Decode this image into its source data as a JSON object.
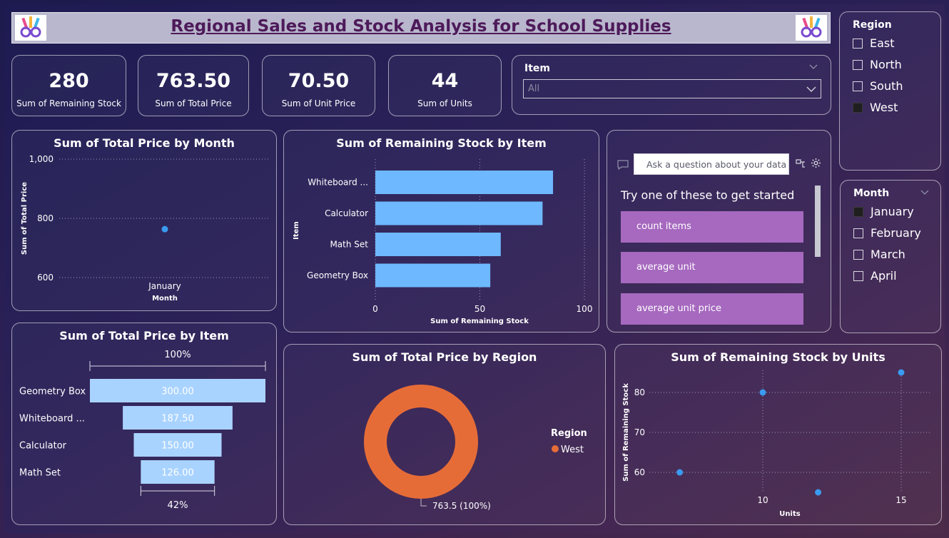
{
  "header": {
    "title": "Regional Sales and Stock Analysis for School Supplies"
  },
  "kpis": [
    {
      "value": "280",
      "label": "Sum of Remaining Stock"
    },
    {
      "value": "763.50",
      "label": "Sum of Total Price"
    },
    {
      "value": "70.50",
      "label": "Sum of Unit Price"
    },
    {
      "value": "44",
      "label": "Sum of Units"
    }
  ],
  "item_filter": {
    "title": "Item",
    "value": "All"
  },
  "region_slicer": {
    "title": "Region",
    "items": [
      {
        "label": "East",
        "checked": false
      },
      {
        "label": "North",
        "checked": false
      },
      {
        "label": "South",
        "checked": false
      },
      {
        "label": "West",
        "checked": true
      }
    ]
  },
  "month_slicer": {
    "title": "Month",
    "items": [
      {
        "label": "January",
        "checked": true
      },
      {
        "label": "February",
        "checked": false
      },
      {
        "label": "March",
        "checked": false
      },
      {
        "label": "April",
        "checked": false
      }
    ]
  },
  "qa": {
    "placeholder": "Ask a question about your data",
    "prompt": "Try one of these to get started",
    "suggestions": [
      "count items",
      "average unit",
      "average unit price"
    ]
  },
  "colors": {
    "bar": "#6db8ff",
    "funnel": "#a9d3ff",
    "donut": "#e66c37",
    "point": "#3a9bf0",
    "chip": "#a669bf"
  },
  "chart_data": [
    {
      "id": "price_by_month",
      "type": "scatter",
      "title": "Sum of Total Price by Month",
      "xlabel": "Month",
      "ylabel": "Sum of Total Price",
      "categories": [
        "January"
      ],
      "values": [
        763.5
      ],
      "yticks": [
        "1,000",
        "800",
        "600"
      ],
      "ylim": [
        600,
        1000
      ],
      "grid": true
    },
    {
      "id": "stock_by_item",
      "type": "bar",
      "orientation": "horizontal",
      "title": "Sum of Remaining Stock by Item",
      "xlabel": "Sum of Remaining Stock",
      "ylabel": "Item",
      "categories": [
        "Whiteboard ...",
        "Calculator",
        "Math Set",
        "Geometry Box"
      ],
      "values": [
        85,
        80,
        60,
        55
      ],
      "xticks": [
        "0",
        "50",
        "100"
      ],
      "xlim": [
        0,
        100
      ],
      "grid": true
    },
    {
      "id": "price_by_item",
      "type": "bar",
      "subtype": "funnel",
      "title": "Sum of Total Price by Item",
      "categories": [
        "Geometry Box",
        "Whiteboard ...",
        "Calculator",
        "Math Set"
      ],
      "values": [
        300,
        187.5,
        150,
        126
      ],
      "value_labels": [
        "300.00",
        "187.50",
        "150.00",
        "126.00"
      ],
      "top_label": "100%",
      "bottom_label": "42%"
    },
    {
      "id": "price_by_region",
      "type": "pie",
      "subtype": "donut",
      "title": "Sum of Total Price by Region",
      "legend_title": "Region",
      "legend_position": "right",
      "slices": [
        {
          "name": "West",
          "value": 763.5
        }
      ],
      "data_label": "763.5 (100%)"
    },
    {
      "id": "stock_by_units",
      "type": "scatter",
      "title": "Sum of Remaining Stock by Units",
      "xlabel": "Units",
      "ylabel": "Sum of Remaining Stock",
      "points": [
        {
          "x": 7,
          "y": 60
        },
        {
          "x": 10,
          "y": 80
        },
        {
          "x": 12,
          "y": 55
        },
        {
          "x": 15,
          "y": 85
        }
      ],
      "xticks": [
        "10",
        "15"
      ],
      "yticks": [
        "80",
        "70",
        "60"
      ],
      "grid": true
    }
  ]
}
